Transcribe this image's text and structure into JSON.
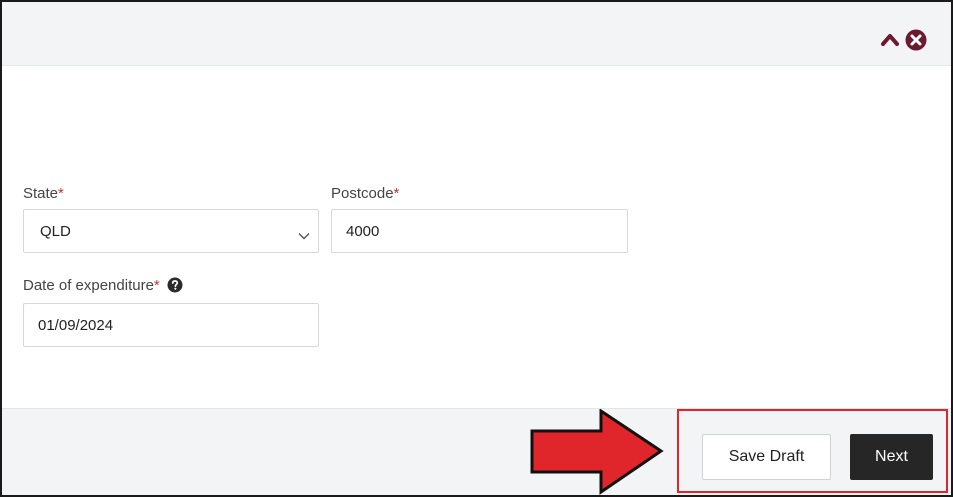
{
  "header": {
    "collapse_icon": "chevron-up-icon",
    "close_icon": "times-circle-icon",
    "accent_color": "#6d1a2f"
  },
  "form": {
    "state": {
      "label": "State",
      "required_mark": "*",
      "value": "QLD"
    },
    "postcode": {
      "label": "Postcode",
      "required_mark": "*",
      "value": "4000"
    },
    "date": {
      "label": "Date of expenditure",
      "required_mark": "*",
      "help_icon": "question-circle-icon",
      "value": "01/09/2024"
    }
  },
  "footer": {
    "save_draft_label": "Save Draft",
    "next_label": "Next"
  },
  "annotation": {
    "arrow_icon": "right-arrow-icon",
    "highlight_color": "#e0262b"
  }
}
